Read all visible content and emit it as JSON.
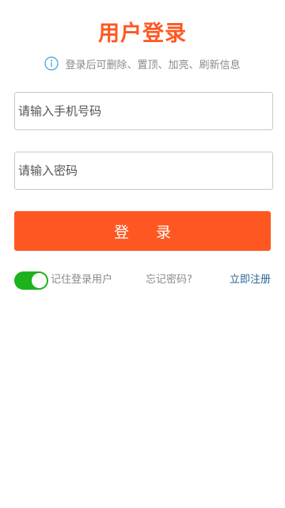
{
  "page": {
    "title": "用户登录",
    "hint": "登录后可删除、置顶、加亮、刷新信息"
  },
  "form": {
    "phone_placeholder": "请输入手机号码",
    "phone_value": "",
    "password_placeholder": "请输入密码",
    "password_value": "",
    "login_label": "登 录"
  },
  "options": {
    "remember_on": true,
    "remember_label": "记住登录用户",
    "forgot_label": "忘记密码?",
    "register_label": "立即注册"
  },
  "icons": {
    "hint_icon": "info-icon"
  },
  "colors": {
    "accent": "#ff5722",
    "toggle_on": "#1db21d",
    "info_icon": "#3a9fd9",
    "link": "#2a6496"
  }
}
